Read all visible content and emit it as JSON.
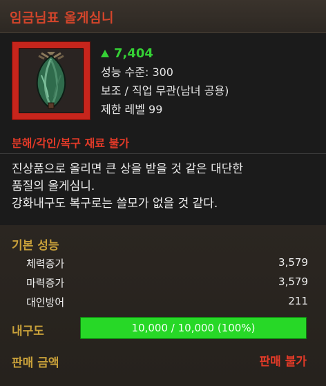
{
  "title": "임금님표 올게심니",
  "score": "7,404",
  "stats": {
    "power_level": "성능 수준: 300",
    "type": "보조 / 직업 무관(남녀 공용)",
    "level_limit": "제한 레벨 99"
  },
  "warning": "분해/각인/복구 재료 불가",
  "description": [
    "진상품으로 올리면 큰 상을 받을 것 같은 대단한",
    "품질의 올게심니.",
    "강화내구도 복구로는 쓸모가 없을 것 같다."
  ],
  "base_performance": {
    "title": "기본 성능",
    "rows": [
      {
        "label": "체력증가",
        "value": "3,579"
      },
      {
        "label": "마력증가",
        "value": "3,579"
      },
      {
        "label": "대인방어",
        "value": "211"
      }
    ]
  },
  "durability": {
    "label": "내구도",
    "text": "10,000 / 10,000 (100%)",
    "fraction": 1.0
  },
  "sale": {
    "label": "판매 금액",
    "value": "판매 불가"
  },
  "colors": {
    "title": "#d4452b",
    "score": "#35d135",
    "warning": "#e23a28",
    "section": "#c9a13a",
    "durability_bar": "#1ed41e",
    "frame": "#c7251c"
  },
  "icons": {
    "item": "rice-sheaf-icon",
    "score_arrow": "up-triangle-icon"
  }
}
